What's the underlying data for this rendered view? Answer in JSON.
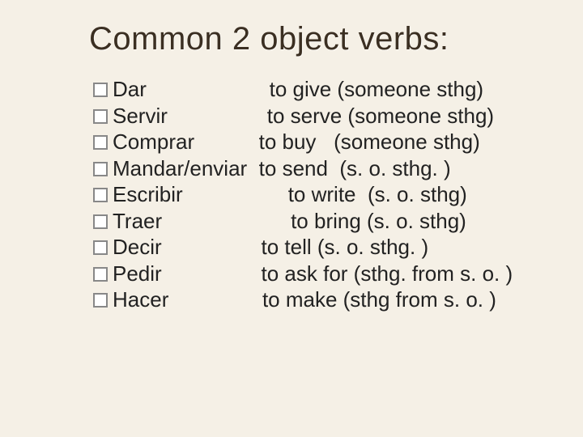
{
  "title": "Common 2 object verbs:",
  "rows": [
    {
      "verb": "Dar",
      "pad": "                     ",
      "def": "to give (someone sthg)"
    },
    {
      "verb": "Servir",
      "pad": "                 ",
      "def": "to serve (someone sthg)"
    },
    {
      "verb": "Comprar",
      "pad": "           ",
      "def": "to buy   (someone sthg)"
    },
    {
      "verb": "Mandar/enviar",
      "pad": "  ",
      "def": "to send  (s. o. sthg. )"
    },
    {
      "verb": "Escribir",
      "pad": "                  ",
      "def": "to write  (s. o. sthg)"
    },
    {
      "verb": "Traer",
      "pad": "                      ",
      "def": "to bring (s. o. sthg)"
    },
    {
      "verb": "Decir",
      "pad": "                 ",
      "def": "to tell (s. o. sthg. )"
    },
    {
      "verb": "Pedir",
      "pad": "                 ",
      "def": "to ask for (sthg. from s. o. )"
    },
    {
      "verb": "Hacer",
      "pad": "                ",
      "def": "to make (sthg from s. o. )"
    }
  ]
}
